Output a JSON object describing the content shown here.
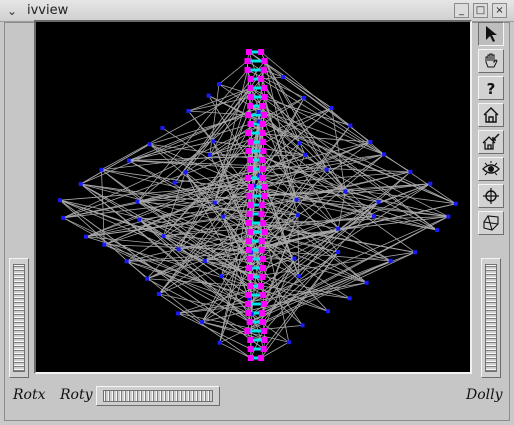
{
  "window": {
    "title": "ivview"
  },
  "icons": {
    "window_menu": "chevron-down-icon",
    "minimize": "minimize-icon",
    "maximize": "maximize-icon",
    "close": "close-icon"
  },
  "toolbar": [
    {
      "id": "pick",
      "icon": "arrow-cursor-icon",
      "active": true
    },
    {
      "id": "view",
      "icon": "hand-icon",
      "active": false
    },
    {
      "id": "help",
      "icon": "help-icon",
      "label": "?",
      "active": false
    },
    {
      "id": "home",
      "icon": "home-icon",
      "active": false
    },
    {
      "id": "set-home",
      "icon": "set-home-icon",
      "active": false
    },
    {
      "id": "view-all",
      "icon": "eye-icon",
      "active": false
    },
    {
      "id": "seek",
      "icon": "crosshair-icon",
      "active": false
    },
    {
      "id": "perspective",
      "icon": "perspective-icon",
      "active": false
    }
  ],
  "thumbwheels": {
    "rotx": "Rotx",
    "roty": "Roty",
    "dolly": "Dolly"
  },
  "colors": {
    "background": "#000000",
    "edges": "#a8a8a8",
    "nodes_outer": "#1a1aff",
    "nodes_center": "#ff00ff",
    "center_bars": "#00e5e5"
  }
}
